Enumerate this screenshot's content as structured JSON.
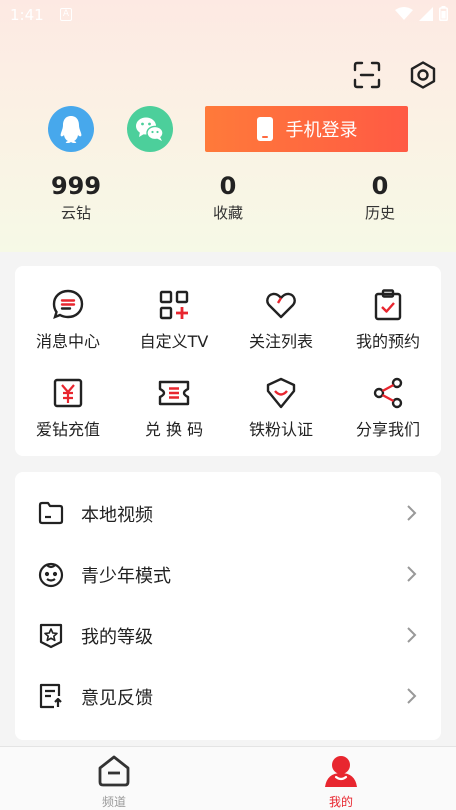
{
  "status_bar": {
    "time": "1:41",
    "notif_glyph": "A"
  },
  "top_actions": {
    "scan_icon": "scan-icon",
    "settings_icon": "settings-icon"
  },
  "login": {
    "phone_login_label": "手机登录"
  },
  "stats": [
    {
      "value": "999",
      "label": "云钻"
    },
    {
      "value": "0",
      "label": "收藏"
    },
    {
      "value": "0",
      "label": "历史"
    }
  ],
  "grid": [
    {
      "label": "消息中心",
      "icon": "message-icon"
    },
    {
      "label": "自定义TV",
      "icon": "custom-tv-icon"
    },
    {
      "label": "关注列表",
      "icon": "heart-icon"
    },
    {
      "label": "我的预约",
      "icon": "reservation-icon"
    },
    {
      "label": "爱钻充值",
      "icon": "recharge-icon"
    },
    {
      "label": "兑 换 码",
      "icon": "redeem-code-icon"
    },
    {
      "label": "铁粉认证",
      "icon": "fan-badge-icon"
    },
    {
      "label": "分享我们",
      "icon": "share-icon"
    }
  ],
  "menu": [
    {
      "label": "本地视频",
      "icon": "folder-icon"
    },
    {
      "label": "青少年模式",
      "icon": "child-face-icon"
    },
    {
      "label": "我的等级",
      "icon": "level-star-icon"
    },
    {
      "label": "意见反馈",
      "icon": "feedback-icon"
    }
  ],
  "tabs": [
    {
      "label": "频道",
      "icon": "home-icon",
      "active": false
    },
    {
      "label": "我的",
      "icon": "profile-icon",
      "active": true
    }
  ],
  "colors": {
    "accent": "#e8262f",
    "login_start": "#ff7a3a",
    "login_end": "#ff5a44",
    "qq": "#47a8ec",
    "wechat": "#4ccf9b"
  }
}
